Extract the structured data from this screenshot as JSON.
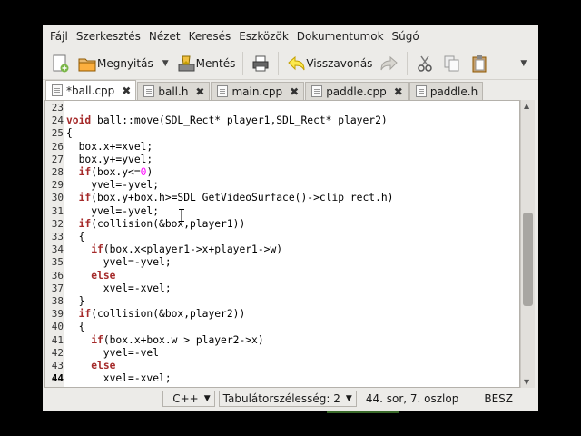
{
  "menu": [
    "Fájl",
    "Szerkesztés",
    "Nézet",
    "Keresés",
    "Eszközök",
    "Dokumentumok",
    "Súgó"
  ],
  "toolbar": {
    "open_label": "Megnyitás",
    "save_label": "Mentés",
    "undo_label": "Visszavonás"
  },
  "tabs": [
    {
      "label": "*ball.cpp",
      "active": true
    },
    {
      "label": "ball.h",
      "active": false
    },
    {
      "label": "main.cpp",
      "active": false
    },
    {
      "label": "paddle.cpp",
      "active": false
    },
    {
      "label": "paddle.h",
      "active": false
    }
  ],
  "code": {
    "line_numbers": [
      "23",
      "24",
      "25",
      "26",
      "27",
      "28",
      "29",
      "30",
      "31",
      "32",
      "33",
      "34",
      "35",
      "36",
      "37",
      "38",
      "39",
      "40",
      "41",
      "42",
      "43",
      "44"
    ],
    "current_line": "44",
    "lines": [
      "",
      "void ball::move(SDL_Rect* player1,SDL_Rect* player2)",
      "{",
      "  box.x+=xvel;",
      "  box.y+=yvel;",
      "  if(box.y<=0)",
      "    yvel=-yvel;",
      "  if(box.y+box.h>=SDL_GetVideoSurface()->clip_rect.h)",
      "    yvel=-yvel;",
      "  if(collision(&box,player1))",
      "  {",
      "    if(box.x<player1->x+player1->w)",
      "      yvel=-yvel;",
      "    else",
      "      xvel=-xvel;",
      "  }",
      "  if(collision(&box,player2))",
      "  {",
      "    if(box.x+box.w > player2->x)",
      "      yvel=-vel",
      "    else",
      "      xvel=-xvel;"
    ]
  },
  "status": {
    "language": "C++",
    "tab_width": "Tabulátorszélesség:  2",
    "position": "44. sor, 7. oszlop",
    "mode": "BESZ"
  },
  "colors": {
    "keyword": "#a52a2a",
    "number": "#ff00ff"
  }
}
